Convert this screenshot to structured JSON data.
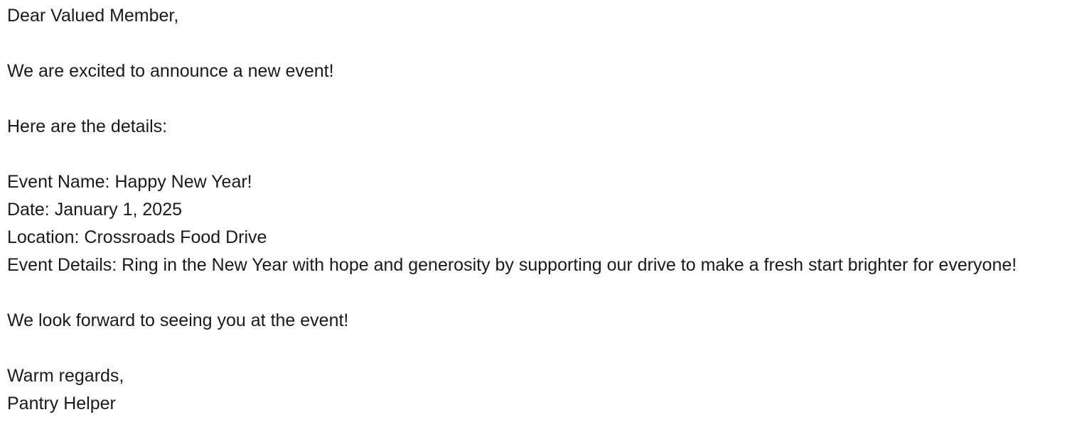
{
  "email": {
    "greeting": "Dear Valued Member,",
    "intro": "We are excited to announce a new event!",
    "details_heading": "Here are the details:",
    "event_name": "Event Name: Happy New Year!",
    "date": "Date: January 1, 2025",
    "location": "Location: Crossroads Food Drive",
    "event_details": "Event Details: Ring in the New Year with hope and generosity by supporting our drive to make a fresh start brighter for everyone!",
    "closing_line": "We look forward to seeing you at the event!",
    "sign_off": "Warm regards,",
    "signature": "Pantry Helper"
  }
}
